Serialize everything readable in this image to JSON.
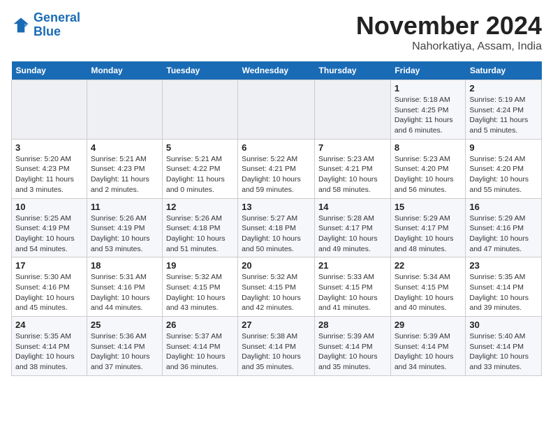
{
  "header": {
    "logo_line1": "General",
    "logo_line2": "Blue",
    "month": "November 2024",
    "location": "Nahorkatiya, Assam, India"
  },
  "weekdays": [
    "Sunday",
    "Monday",
    "Tuesday",
    "Wednesday",
    "Thursday",
    "Friday",
    "Saturday"
  ],
  "weeks": [
    [
      {
        "day": "",
        "info": ""
      },
      {
        "day": "",
        "info": ""
      },
      {
        "day": "",
        "info": ""
      },
      {
        "day": "",
        "info": ""
      },
      {
        "day": "",
        "info": ""
      },
      {
        "day": "1",
        "info": "Sunrise: 5:18 AM\nSunset: 4:25 PM\nDaylight: 11 hours and 6 minutes."
      },
      {
        "day": "2",
        "info": "Sunrise: 5:19 AM\nSunset: 4:24 PM\nDaylight: 11 hours and 5 minutes."
      }
    ],
    [
      {
        "day": "3",
        "info": "Sunrise: 5:20 AM\nSunset: 4:23 PM\nDaylight: 11 hours and 3 minutes."
      },
      {
        "day": "4",
        "info": "Sunrise: 5:21 AM\nSunset: 4:23 PM\nDaylight: 11 hours and 2 minutes."
      },
      {
        "day": "5",
        "info": "Sunrise: 5:21 AM\nSunset: 4:22 PM\nDaylight: 11 hours and 0 minutes."
      },
      {
        "day": "6",
        "info": "Sunrise: 5:22 AM\nSunset: 4:21 PM\nDaylight: 10 hours and 59 minutes."
      },
      {
        "day": "7",
        "info": "Sunrise: 5:23 AM\nSunset: 4:21 PM\nDaylight: 10 hours and 58 minutes."
      },
      {
        "day": "8",
        "info": "Sunrise: 5:23 AM\nSunset: 4:20 PM\nDaylight: 10 hours and 56 minutes."
      },
      {
        "day": "9",
        "info": "Sunrise: 5:24 AM\nSunset: 4:20 PM\nDaylight: 10 hours and 55 minutes."
      }
    ],
    [
      {
        "day": "10",
        "info": "Sunrise: 5:25 AM\nSunset: 4:19 PM\nDaylight: 10 hours and 54 minutes."
      },
      {
        "day": "11",
        "info": "Sunrise: 5:26 AM\nSunset: 4:19 PM\nDaylight: 10 hours and 53 minutes."
      },
      {
        "day": "12",
        "info": "Sunrise: 5:26 AM\nSunset: 4:18 PM\nDaylight: 10 hours and 51 minutes."
      },
      {
        "day": "13",
        "info": "Sunrise: 5:27 AM\nSunset: 4:18 PM\nDaylight: 10 hours and 50 minutes."
      },
      {
        "day": "14",
        "info": "Sunrise: 5:28 AM\nSunset: 4:17 PM\nDaylight: 10 hours and 49 minutes."
      },
      {
        "day": "15",
        "info": "Sunrise: 5:29 AM\nSunset: 4:17 PM\nDaylight: 10 hours and 48 minutes."
      },
      {
        "day": "16",
        "info": "Sunrise: 5:29 AM\nSunset: 4:16 PM\nDaylight: 10 hours and 47 minutes."
      }
    ],
    [
      {
        "day": "17",
        "info": "Sunrise: 5:30 AM\nSunset: 4:16 PM\nDaylight: 10 hours and 45 minutes."
      },
      {
        "day": "18",
        "info": "Sunrise: 5:31 AM\nSunset: 4:16 PM\nDaylight: 10 hours and 44 minutes."
      },
      {
        "day": "19",
        "info": "Sunrise: 5:32 AM\nSunset: 4:15 PM\nDaylight: 10 hours and 43 minutes."
      },
      {
        "day": "20",
        "info": "Sunrise: 5:32 AM\nSunset: 4:15 PM\nDaylight: 10 hours and 42 minutes."
      },
      {
        "day": "21",
        "info": "Sunrise: 5:33 AM\nSunset: 4:15 PM\nDaylight: 10 hours and 41 minutes."
      },
      {
        "day": "22",
        "info": "Sunrise: 5:34 AM\nSunset: 4:15 PM\nDaylight: 10 hours and 40 minutes."
      },
      {
        "day": "23",
        "info": "Sunrise: 5:35 AM\nSunset: 4:14 PM\nDaylight: 10 hours and 39 minutes."
      }
    ],
    [
      {
        "day": "24",
        "info": "Sunrise: 5:35 AM\nSunset: 4:14 PM\nDaylight: 10 hours and 38 minutes."
      },
      {
        "day": "25",
        "info": "Sunrise: 5:36 AM\nSunset: 4:14 PM\nDaylight: 10 hours and 37 minutes."
      },
      {
        "day": "26",
        "info": "Sunrise: 5:37 AM\nSunset: 4:14 PM\nDaylight: 10 hours and 36 minutes."
      },
      {
        "day": "27",
        "info": "Sunrise: 5:38 AM\nSunset: 4:14 PM\nDaylight: 10 hours and 35 minutes."
      },
      {
        "day": "28",
        "info": "Sunrise: 5:39 AM\nSunset: 4:14 PM\nDaylight: 10 hours and 35 minutes."
      },
      {
        "day": "29",
        "info": "Sunrise: 5:39 AM\nSunset: 4:14 PM\nDaylight: 10 hours and 34 minutes."
      },
      {
        "day": "30",
        "info": "Sunrise: 5:40 AM\nSunset: 4:14 PM\nDaylight: 10 hours and 33 minutes."
      }
    ]
  ]
}
